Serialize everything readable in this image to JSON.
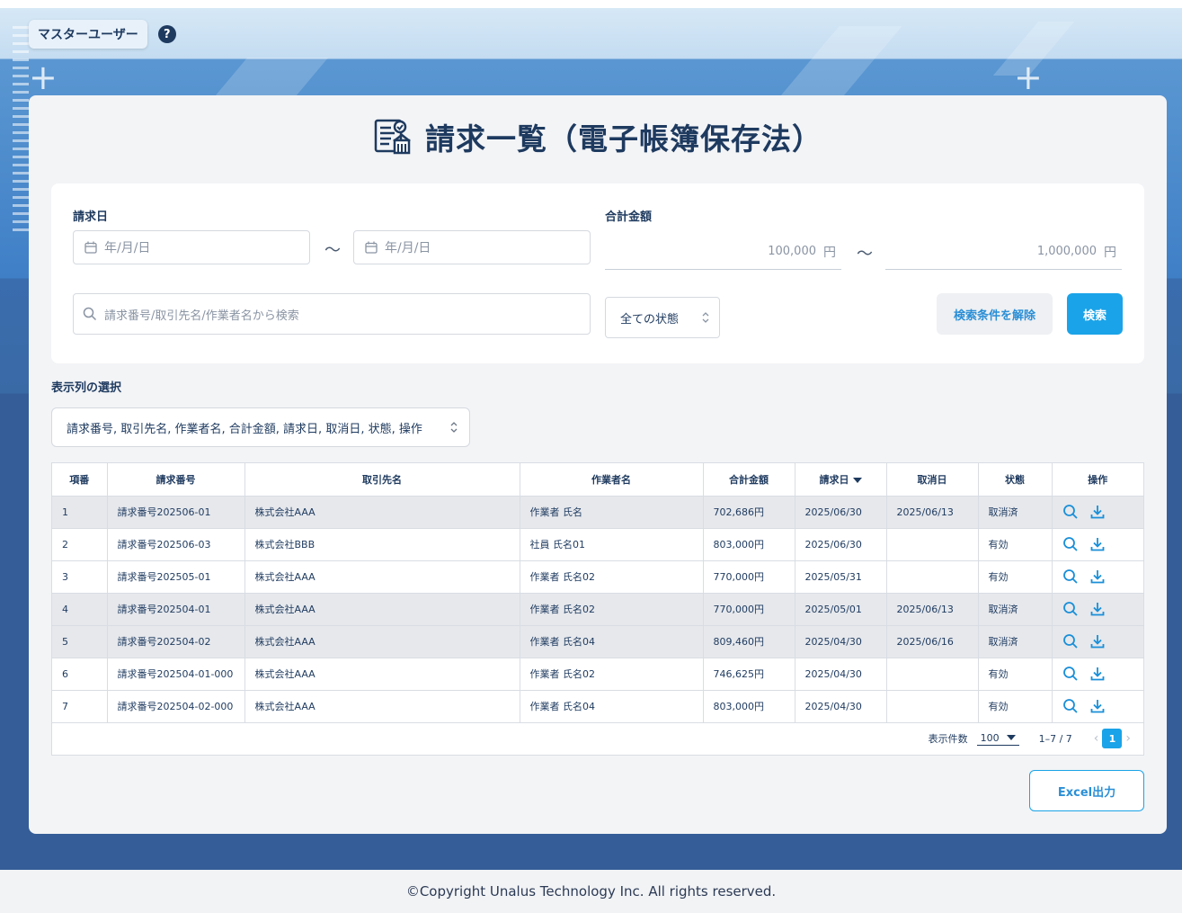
{
  "header": {
    "user_badge": "マスターユーザー",
    "help": "?"
  },
  "page": {
    "title": "請求一覧（電子帳簿保存法）"
  },
  "search": {
    "date_label": "請求日",
    "date_from_placeholder": "年/月/日",
    "date_to_placeholder": "年/月/日",
    "tilde": "〜",
    "amount_label": "合計金額",
    "amount_min": "100,000",
    "amount_max": "1,000,000",
    "yen": "円",
    "text_placeholder": "請求番号/取引先名/作業者名から検索",
    "status_value": "全ての状態",
    "clear_label": "検索条件を解除",
    "search_label": "検索"
  },
  "columns_select": {
    "label": "表示列の選択",
    "value": "請求番号, 取引先名, 作業者名, 合計金額, 請求日, 取消日, 状態, 操作"
  },
  "table": {
    "headers": [
      "項番",
      "請求番号",
      "取引先名",
      "作業者名",
      "合計金額",
      "請求日",
      "取消日",
      "状態",
      "操作"
    ],
    "rows": [
      {
        "no": "1",
        "invoice": "請求番号202506-01",
        "client": "株式会社AAA",
        "worker": "作業者 氏名",
        "amount": "702,686円",
        "date": "2025/06/30",
        "cancel_date": "2025/06/13",
        "status": "取消済",
        "cancelled": true
      },
      {
        "no": "2",
        "invoice": "請求番号202506-03",
        "client": "株式会社BBB",
        "worker": "社員 氏名01",
        "amount": "803,000円",
        "date": "2025/06/30",
        "cancel_date": "",
        "status": "有効",
        "cancelled": false
      },
      {
        "no": "3",
        "invoice": "請求番号202505-01",
        "client": "株式会社AAA",
        "worker": "作業者 氏名02",
        "amount": "770,000円",
        "date": "2025/05/31",
        "cancel_date": "",
        "status": "有効",
        "cancelled": false
      },
      {
        "no": "4",
        "invoice": "請求番号202504-01",
        "client": "株式会社AAA",
        "worker": "作業者 氏名02",
        "amount": "770,000円",
        "date": "2025/05/01",
        "cancel_date": "2025/06/13",
        "status": "取消済",
        "cancelled": true
      },
      {
        "no": "5",
        "invoice": "請求番号202504-02",
        "client": "株式会社AAA",
        "worker": "作業者 氏名04",
        "amount": "809,460円",
        "date": "2025/04/30",
        "cancel_date": "2025/06/16",
        "status": "取消済",
        "cancelled": true
      },
      {
        "no": "6",
        "invoice": "請求番号202504-01-000",
        "client": "株式会社AAA",
        "worker": "作業者 氏名02",
        "amount": "746,625円",
        "date": "2025/04/30",
        "cancel_date": "",
        "status": "有効",
        "cancelled": false
      },
      {
        "no": "7",
        "invoice": "請求番号202504-02-000",
        "client": "株式会社AAA",
        "worker": "作業者 氏名04",
        "amount": "803,000円",
        "date": "2025/04/30",
        "cancel_date": "",
        "status": "有効",
        "cancelled": false
      }
    ],
    "row_icons": [
      "search-icon",
      "download-icon"
    ]
  },
  "pagination": {
    "per_page_label": "表示件数",
    "per_page_value": "100",
    "range": "1–7 / 7",
    "current_page": "1"
  },
  "actions": {
    "excel_label": "Excel出力"
  },
  "footer": {
    "copyright": "©Copyright Unalus Technology Inc. All rights reserved."
  },
  "colors": {
    "accent": "#1aa3e8",
    "text": "#1e3a5f",
    "cancelled_row": "#e6e8ec"
  }
}
